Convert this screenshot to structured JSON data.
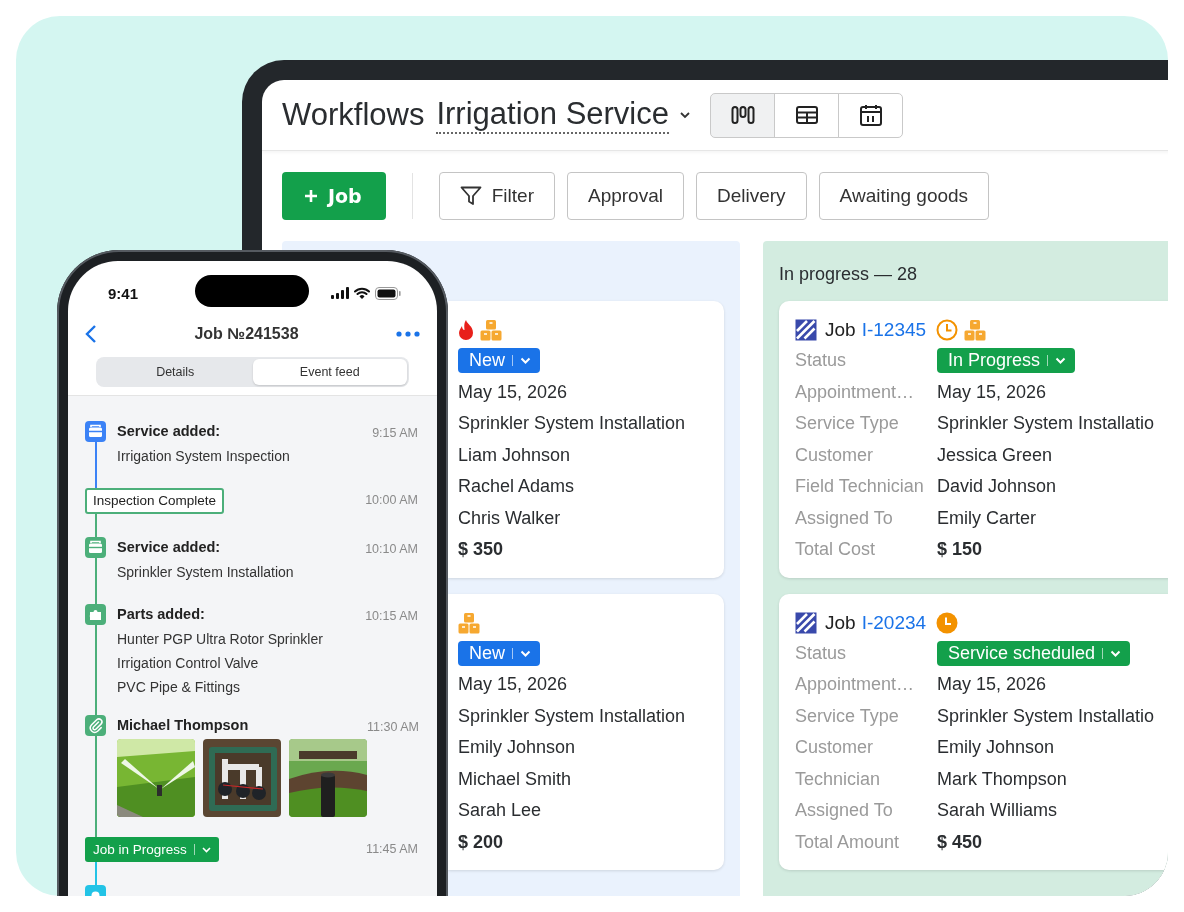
{
  "tablet": {
    "title": "Workflows",
    "pipeline": "Irrigation Service",
    "views": [
      {
        "kind": "board",
        "selected": true
      },
      {
        "kind": "table",
        "selected": false
      },
      {
        "kind": "calendar",
        "selected": false
      }
    ],
    "add_button": "Job",
    "filters": [
      {
        "kind": "filter",
        "label": "Filter"
      },
      {
        "kind": "preset",
        "label": "Approval"
      },
      {
        "kind": "preset",
        "label": "Delivery"
      },
      {
        "kind": "preset",
        "label": "Awaiting goods"
      }
    ],
    "columns": [
      {
        "color": "#eaf2fd",
        "cards": [
          {
            "badges": [
              {
                "kind": "urgent"
              },
              {
                "kind": "parts"
              }
            ],
            "fields": [
              {
                "kind": "status",
                "value": "New",
                "color": "#1a73e8"
              },
              {
                "kind": "text",
                "value": "May 15, 2026"
              },
              {
                "kind": "text",
                "value": "Sprinkler System Installation"
              },
              {
                "kind": "text",
                "value": "Liam Johnson"
              },
              {
                "kind": "text",
                "value": "Rachel Adams"
              },
              {
                "kind": "text",
                "value": "Chris Walker"
              },
              {
                "kind": "amount",
                "value": "$ 350"
              }
            ]
          },
          {
            "badges": [
              {
                "kind": "parts"
              }
            ],
            "fields": [
              {
                "kind": "status",
                "value": "New",
                "color": "#1a73e8"
              },
              {
                "kind": "text",
                "value": "May 15, 2026"
              },
              {
                "kind": "text",
                "value": "Sprinkler System Installation"
              },
              {
                "kind": "text",
                "value": "Emily Johnson"
              },
              {
                "kind": "text",
                "value": "Michael Smith"
              },
              {
                "kind": "text",
                "value": "Sarah Lee"
              },
              {
                "kind": "amount",
                "value": "$ 200"
              }
            ]
          }
        ]
      },
      {
        "title": "In progress — 28",
        "color": "#d3ece0",
        "cards": [
          {
            "job": {
              "prefix": "Job",
              "id": "I-12345"
            },
            "badges": [
              {
                "kind": "pending"
              },
              {
                "kind": "parts"
              }
            ],
            "fields": [
              {
                "kind": "status",
                "label": "Status",
                "value": "In Progress",
                "color": "#13a04b"
              },
              {
                "kind": "text",
                "label": "Appointment…",
                "value": "May 15, 2026"
              },
              {
                "kind": "text",
                "label": "Service Type",
                "value": "Sprinkler System Installatio"
              },
              {
                "kind": "text",
                "label": "Customer",
                "value": "Jessica Green"
              },
              {
                "kind": "text",
                "label": "Field Technician",
                "value": "David Johnson"
              },
              {
                "kind": "text",
                "label": "Assigned To",
                "value": "Emily Carter"
              },
              {
                "kind": "amount",
                "label": "Total Cost",
                "value": "$ 150"
              }
            ]
          },
          {
            "job": {
              "prefix": "Job",
              "id": "I-20234"
            },
            "badges": [
              {
                "kind": "overdue"
              }
            ],
            "fields": [
              {
                "kind": "status",
                "label": "Status",
                "value": "Service scheduled",
                "color": "#13a04b"
              },
              {
                "kind": "text",
                "label": "Appointment…",
                "value": "May 15, 2026"
              },
              {
                "kind": "text",
                "label": "Service Type",
                "value": "Sprinkler System Installatio"
              },
              {
                "kind": "text",
                "label": "Customer",
                "value": "Emily Johnson"
              },
              {
                "kind": "text",
                "label": "Technician",
                "value": "Mark Thompson"
              },
              {
                "kind": "text",
                "label": "Assigned To",
                "value": "Sarah Williams"
              },
              {
                "kind": "amount",
                "label": "Total Amount",
                "value": "$ 450"
              }
            ]
          }
        ]
      }
    ]
  },
  "phone": {
    "time": "9:41",
    "title": "Job №241538",
    "tabs": [
      {
        "label": "Details",
        "selected": false
      },
      {
        "label": "Event feed",
        "selected": true
      }
    ],
    "events": [
      {
        "kind": "service",
        "color": "#3b82f6",
        "title": "Service added:",
        "lines": [
          "Irrigation System Inspection"
        ],
        "time": "9:15 AM"
      },
      {
        "kind": "milestone",
        "color": "#4caf7a",
        "label": "Inspection Complete",
        "time": "10:00 AM"
      },
      {
        "kind": "service",
        "color": "#4caf7a",
        "title": "Service added:",
        "lines": [
          "Sprinkler System Installation"
        ],
        "time": "10:10 AM"
      },
      {
        "kind": "parts",
        "color": "#4caf7a",
        "title": "Parts added:",
        "lines": [
          "Hunter PGP Ultra Rotor Sprinkler",
          "Irrigation Control Valve",
          "PVC Pipe & Fittings"
        ],
        "time": "10:15 AM"
      },
      {
        "kind": "attachment",
        "color": "#4caf7a",
        "title": "Michael Thompson",
        "time": "11:30 AM"
      },
      {
        "kind": "status",
        "color": "#22c3e6",
        "label": "Job in Progress",
        "time": "11:45 AM"
      },
      {
        "kind": "partial",
        "color": "#22c3e6"
      }
    ]
  }
}
